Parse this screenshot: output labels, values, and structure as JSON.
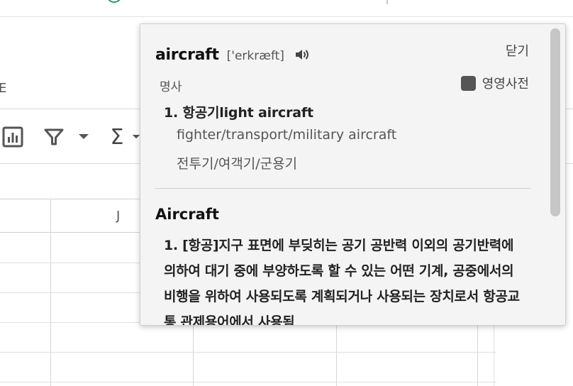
{
  "spreadsheet": {
    "left_label": "E",
    "column_label": "J"
  },
  "popup": {
    "headword": "aircraft",
    "phonetic": "['erkræft]",
    "close_label": "닫기",
    "part_of_speech": "명사",
    "english_dict_label": "영영사전",
    "sense1": "1. 항공기light aircraft",
    "example_en": "fighter/transport/military aircraft",
    "example_ko": "전투기/여객기/군용기",
    "entry2_title": "Aircraft",
    "entry2_def": "1. [항공]지구 표면에 부딪히는 공기 공반력 이외의 공기반력에 의하여 대기 중에 부양하도록 할 수 있는 어떤 기계, 공중에서의 비행을 위하여 사용되도록 계획되거나 사용되는 장치로서 항공교통 관제용어에서 사용됨"
  },
  "icons": [
    "chart-icon",
    "filter-icon",
    "chevron-down-icon",
    "sigma-icon",
    "speaker-icon"
  ]
}
